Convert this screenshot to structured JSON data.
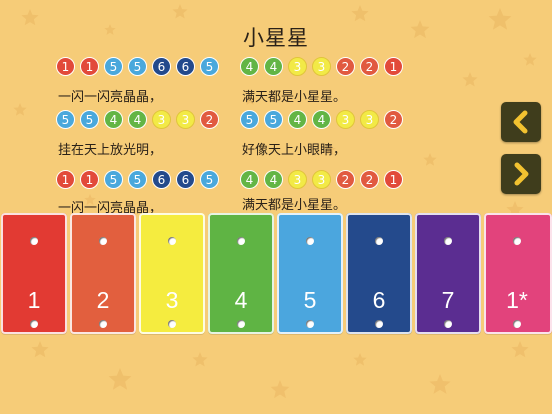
{
  "app": {
    "title": "小星星",
    "note_colors": {
      "1": "#e24a3a",
      "2": "#e15a40",
      "3": "#f2ea46",
      "4": "#63b545",
      "5": "#4aa8dc",
      "6": "#234a8c",
      "7": "#5b2d93",
      "1*": "#e0447e"
    },
    "note_border_default": "#ffffff",
    "note_border_yellow": "#e0c53a"
  },
  "notes": {
    "row1_left": [
      "1",
      "1",
      "5",
      "5",
      "6",
      "6",
      "5"
    ],
    "row1_right": [
      "4",
      "4",
      "3",
      "3",
      "2",
      "2",
      "1"
    ],
    "row2_left": [
      "5",
      "5",
      "4",
      "4",
      "3",
      "3",
      "2"
    ],
    "row2_right": [
      "5",
      "5",
      "4",
      "4",
      "3",
      "3",
      "2"
    ],
    "row3_left": [
      "1",
      "1",
      "5",
      "5",
      "6",
      "6",
      "5"
    ],
    "row3_right": [
      "4",
      "4",
      "3",
      "3",
      "2",
      "2",
      "1"
    ]
  },
  "lyrics": {
    "row1_left": "一闪一闪亮晶晶，",
    "row1_right": "满天都是小星星。",
    "row2_left": "挂在天上放光明，",
    "row2_right": "好像天上小眼睛，",
    "row3_left": "一闪一闪亮晶晶，",
    "row3_right": "满天都是小星星。"
  },
  "nav": {
    "prev_icon": "chevron-left-icon",
    "next_icon": "chevron-right-icon",
    "bg_color": "#3f3d1c",
    "icon_color": "#f2c230"
  },
  "keys": [
    {
      "label": "1",
      "color": "#e23a33"
    },
    {
      "label": "2",
      "color": "#e25f3e"
    },
    {
      "label": "3",
      "color": "#f5ec3f"
    },
    {
      "label": "4",
      "color": "#5fb444"
    },
    {
      "label": "5",
      "color": "#4ba6de"
    },
    {
      "label": "6",
      "color": "#244a8c"
    },
    {
      "label": "7",
      "color": "#5b2d91"
    },
    {
      "label": "1*",
      "color": "#e2437c"
    }
  ]
}
